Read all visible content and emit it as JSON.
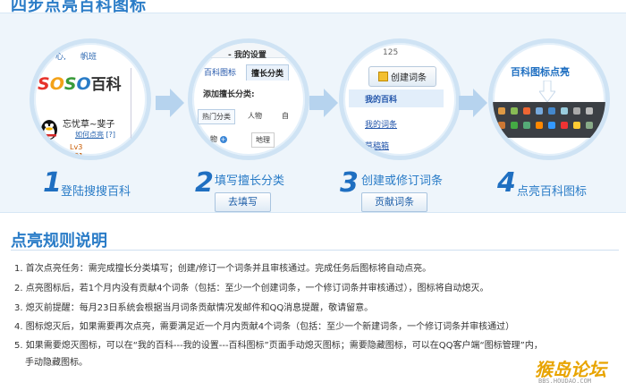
{
  "page": {
    "steps_title": "四步点亮百科图标",
    "rules_title": "点亮规则说明"
  },
  "steps": [
    {
      "number": "1",
      "text": "登陆搜搜百科",
      "button": ""
    },
    {
      "number": "2",
      "text": "填写擅长分类",
      "button": "去填写"
    },
    {
      "number": "3",
      "text": "创建或修订词条",
      "button": "贡献词条"
    },
    {
      "number": "4",
      "text": "点亮百科图标",
      "button": ""
    }
  ],
  "circle1": {
    "top_link_1": "心,",
    "top_link_2": "帆班",
    "logo_text": "SOSO百科",
    "username": "忘忧草~斐子",
    "level_link": "如何点亮",
    "level_badge": "[?]",
    "misc_1": "Lv3",
    "misc_2": "001"
  },
  "circle2": {
    "window_title": "- 我的设置",
    "tab_1": "百科图标",
    "tab_2": "擅长分类",
    "heading": "添加擅长分类:",
    "pill_1": "热门分类",
    "pill_2": "人物",
    "pill_3": "自",
    "item_1": "物",
    "item_2": "地理"
  },
  "circle3": {
    "top_text": "125",
    "create_button": "创建词条",
    "item_1": "我的百科",
    "item_2": "我的词条",
    "item_3": "草稿箱"
  },
  "circle4": {
    "title": "百科图标点亮"
  },
  "rules": [
    "1. 首次点亮任务：需完成擅长分类填写；创建/修订一个词条并且审核通过。完成任务后图标将自动点亮。",
    "2. 点亮图标后，若1个月内没有贡献4个词条（包括：至少一个创建词条，一个修订词条并审核通过），图标将自动熄灭。",
    "3. 熄灭前提醒：每月23日系统会根据当月词条贡献情况发邮件和QQ消息提醒，敬请留意。",
    "4. 图标熄灭后，如果需要再次点亮，需要满足近一个月内贡献4个词条（包括：至少一个新建词条，一个修订词条并审核通过）",
    "5. 如果需要熄灭图标，可以在“我的百科---我的设置---百科图标”页面手动熄灭图标；需要隐藏图标，可以在QQ客户端“图标管理”内，",
    "手动隐藏图标。"
  ],
  "watermark": {
    "name": "猴岛论坛",
    "url": "BBS.HOUDAO.COM"
  },
  "colors": {
    "accent": "#2a7cc7",
    "band": "#eef5fb",
    "step_number": "#1f6fc1",
    "watermark": "#e8a400"
  }
}
